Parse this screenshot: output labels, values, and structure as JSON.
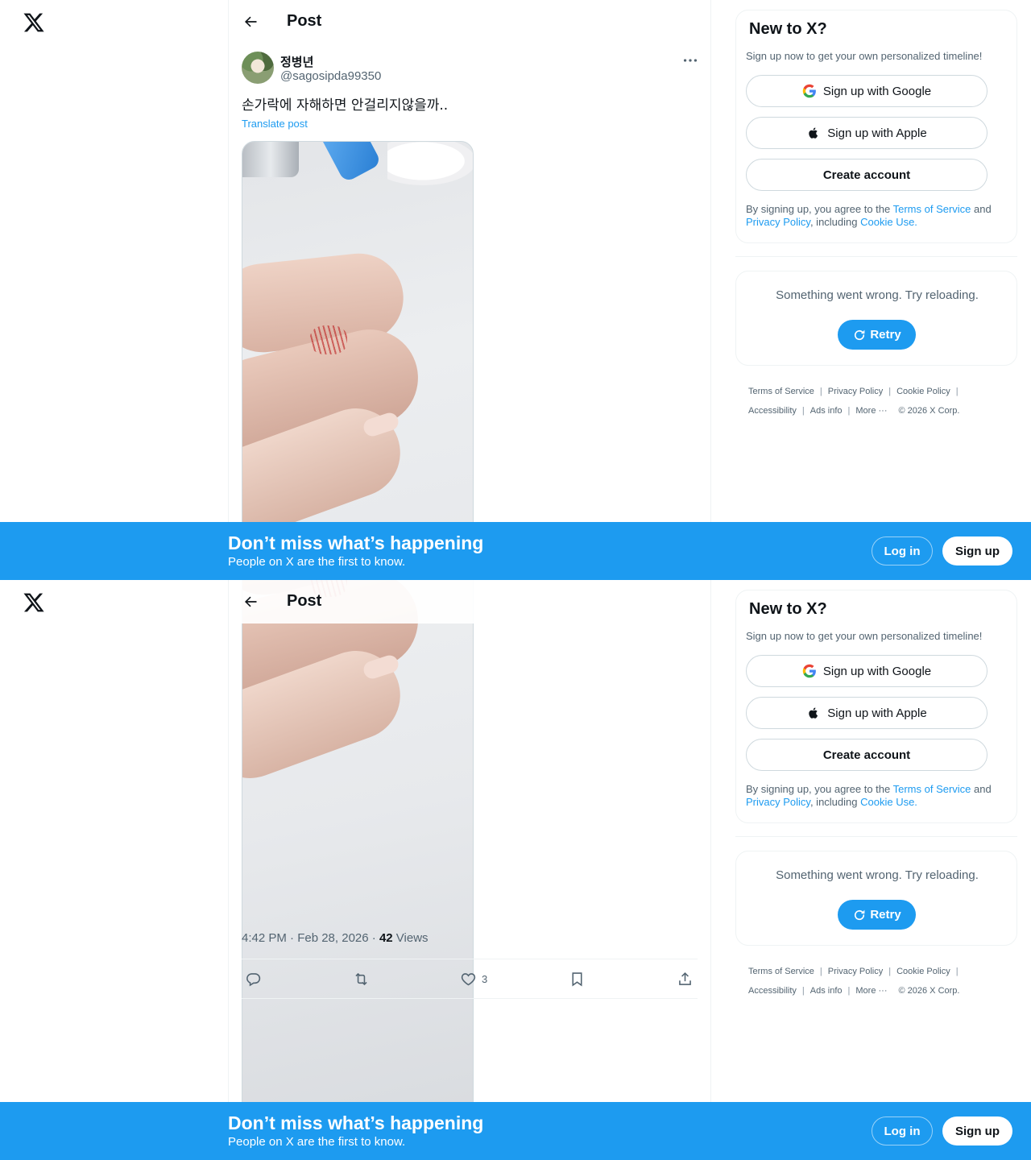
{
  "header": {
    "title": "Post"
  },
  "post": {
    "author_name": "정병년",
    "author_handle": "@sagosipda99350",
    "text": "손가락에 자해하면 안걸리지않을까..",
    "translate_label": "Translate post",
    "time": "4:42 PM · Feb 28, 2026 · ",
    "views_count": "42",
    "views_label": " Views",
    "likes": "3"
  },
  "sidebar": {
    "new_title": "New to X?",
    "new_subtitle": "Sign up now to get your own personalized timeline!",
    "google_label": "Sign up with Google",
    "apple_label": "Sign up with Apple",
    "create_label": "Create account",
    "legal_prefix": "By signing up, you agree to the ",
    "terms_label": "Terms of Service",
    "legal_and": " and ",
    "privacy_label": "Privacy Policy",
    "legal_including": ", including ",
    "cookie_label": "Cookie Use.",
    "error_message": "Something went wrong. Try reloading.",
    "retry_label": "Retry"
  },
  "footer": {
    "terms": "Terms of Service",
    "privacy": "Privacy Policy",
    "cookie": "Cookie Policy",
    "accessibility": "Accessibility",
    "ads": "Ads info",
    "more": "More ···",
    "copyright": "© 2026 X Corp.",
    "sep": "|"
  },
  "banner": {
    "headline": "Don’t miss what’s happening",
    "subline": "People on X are the first to know.",
    "login_label": "Log in",
    "signup_label": "Sign up"
  },
  "colors": {
    "accent": "#1d9bf0",
    "text": "#0f1419",
    "muted": "#536471",
    "border": "#eff3f4"
  },
  "icons": [
    "x-logo-icon",
    "back-arrow-icon",
    "more-icon",
    "reply-icon",
    "repost-icon",
    "like-icon",
    "bookmark-icon",
    "share-icon",
    "google-icon",
    "apple-icon",
    "refresh-icon"
  ]
}
